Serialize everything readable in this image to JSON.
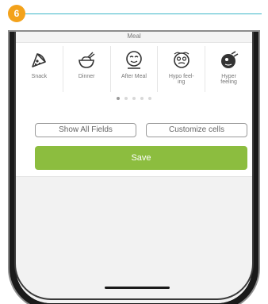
{
  "step_number": "6",
  "colors": {
    "step_badge": "#f3a21b",
    "step_line": "#3bb7c8",
    "save_button": "#8cbd3f"
  },
  "tag_header": {
    "label": "Meal"
  },
  "tags": [
    {
      "label": "Snack",
      "icon": "pizza-slice-icon"
    },
    {
      "label": "Dinner",
      "icon": "rice-bowl-icon"
    },
    {
      "label": "After Meal",
      "icon": "full-face-icon"
    },
    {
      "label": "Hypo feel-\ning",
      "icon": "dizzy-face-icon"
    },
    {
      "label": "Hyper\nfeeling",
      "icon": "chart-face-icon"
    }
  ],
  "pagination": {
    "pages": 5,
    "active": 1
  },
  "buttons": {
    "show_all": "Show All Fields",
    "customize": "Customize cells",
    "save": "Save"
  }
}
